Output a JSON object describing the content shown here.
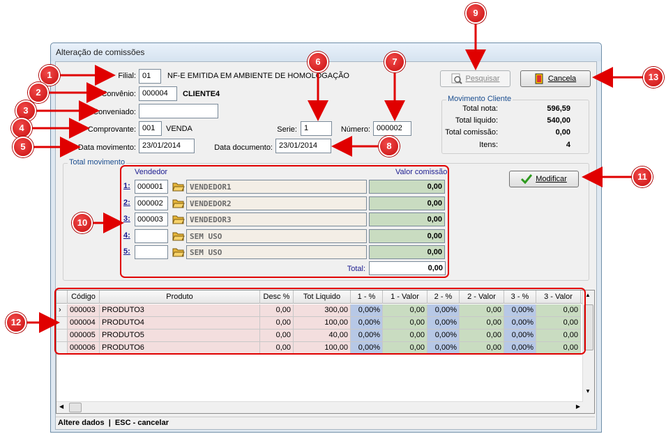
{
  "window": {
    "title": "Alteração de comissões"
  },
  "form": {
    "filial_label": "Filial:",
    "filial_value": "01",
    "filial_desc": "NF-E EMITIDA EM AMBIENTE DE HOMOLOGAÇÃO",
    "convenio_label": "Convênio:",
    "convenio_value": "000004",
    "convenio_desc": "CLIENTE4",
    "conveniado_label": "Conveniado:",
    "conveniado_value": "",
    "comprovante_label": "Comprovante:",
    "comprovante_value": "001",
    "comprovante_desc": "VENDA",
    "data_mov_label": "Data movimento:",
    "data_mov_value": "23/01/2014",
    "serie_label": "Serie:",
    "serie_value": "1",
    "numero_label": "Número:",
    "numero_value": "000002",
    "data_doc_label": "Data documento:",
    "data_doc_value": "23/01/2014"
  },
  "buttons": {
    "pesquisar": "Pesquisar",
    "cancela": "Cancela",
    "modificar": "Modificar"
  },
  "movimento_cliente": {
    "legend": "Movimento Cliente",
    "rows": [
      {
        "label": "Total nota:",
        "value": "596,59"
      },
      {
        "label": "Total liquido:",
        "value": "540,00"
      },
      {
        "label": "Total comissão:",
        "value": "0,00"
      },
      {
        "label": "Itens:",
        "value": "4"
      }
    ]
  },
  "total_movimento": {
    "legend": "Total movimento",
    "col_vendedor": "Vendedor",
    "col_valor": "Valor comissão",
    "rows": [
      {
        "num": "1:",
        "code": "000001",
        "name": "VENDEDOR1",
        "value": "0,00"
      },
      {
        "num": "2:",
        "code": "000002",
        "name": "VENDEDOR2",
        "value": "0,00"
      },
      {
        "num": "3:",
        "code": "000003",
        "name": "VENDEDOR3",
        "value": "0,00"
      },
      {
        "num": "4:",
        "code": "",
        "name": "SEM USO",
        "value": "0,00"
      },
      {
        "num": "5:",
        "code": "",
        "name": "SEM USO",
        "value": "0,00"
      }
    ],
    "total_label": "Total:",
    "total_value": "0,00"
  },
  "grid": {
    "headers": [
      "Código",
      "Produto",
      "Desc %",
      "Tot Liquido",
      "1 - %",
      "1 - Valor",
      "2 - %",
      "2 - Valor",
      "3 - %",
      "3 - Valor"
    ],
    "rows": [
      [
        "000003",
        "PRODUTO3",
        "0,00",
        "300,00",
        "0,00%",
        "0,00",
        "0,00%",
        "0,00",
        "0,00%",
        "0,00"
      ],
      [
        "000004",
        "PRODUTO4",
        "0,00",
        "100,00",
        "0,00%",
        "0,00",
        "0,00%",
        "0,00",
        "0,00%",
        "0,00"
      ],
      [
        "000005",
        "PRODUTO5",
        "0,00",
        "40,00",
        "0,00%",
        "0,00",
        "0,00%",
        "0,00",
        "0,00%",
        "0,00"
      ],
      [
        "000006",
        "PRODUTO6",
        "0,00",
        "100,00",
        "0,00%",
        "0,00",
        "0,00%",
        "0,00",
        "0,00%",
        "0,00"
      ]
    ]
  },
  "status": {
    "text": "Altere dados  |  ESC - cancelar"
  },
  "callouts": [
    "1",
    "2",
    "3",
    "4",
    "5",
    "6",
    "7",
    "8",
    "9",
    "10",
    "11",
    "12",
    "13"
  ]
}
